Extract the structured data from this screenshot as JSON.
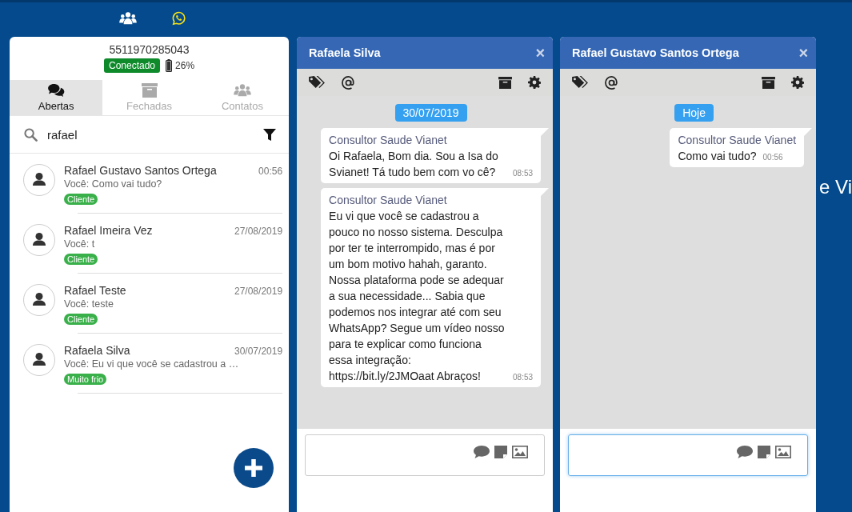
{
  "top_nav": [
    {
      "kind": "team",
      "selected": false
    },
    {
      "kind": "whatsapp",
      "selected": true
    }
  ],
  "sidebar": {
    "phone": "5511970285043",
    "status": "Conectado",
    "battery": "26%",
    "tabs": [
      {
        "label": "Abertas",
        "kind": "chats",
        "selected": true
      },
      {
        "label": "Fechadas",
        "kind": "archive",
        "selected": false
      },
      {
        "label": "Contatos",
        "kind": "team",
        "selected": false
      }
    ],
    "search": {
      "value": "rafael"
    },
    "conversations": [
      {
        "name": "Rafael Gustavo Santos Ortega",
        "time": "00:56",
        "preview": "Você: Como vai tudo?",
        "tag": "Cliente"
      },
      {
        "name": "Rafael Imeira Vez",
        "time": "27/08/2019",
        "preview": "Você: t",
        "tag": "Cliente"
      },
      {
        "name": "Rafael Teste",
        "time": "27/08/2019",
        "preview": "Você: teste",
        "tag": "Cliente"
      },
      {
        "name": "Rafaela Silva",
        "time": "30/07/2019",
        "preview": "Você: Eu vi que você se cadastrou a …",
        "tag": "Muito frio"
      }
    ]
  },
  "chats": [
    {
      "title": "Rafaela Silva",
      "close": "×",
      "date": "30/07/2019",
      "focused": false,
      "messages": [
        {
          "sender": "Consultor Saude Vianet",
          "text": "Oi Rafaela, Bom dia. Sou a Isa do Svianet! Tá tudo bem com vo cê?",
          "time": "08:53"
        },
        {
          "sender": "Consultor Saude Vianet",
          "text": "Eu vi que você se cadastrou a pouco no nosso sistema. Desculpa por ter te interrompido, mas é por um bom motivo hahah, garanto. Nossa plataforma pode se adequar a sua necessidade... Sabia que podemos nos integrar até com seu WhatsApp? Segue um vídeo nosso para te explicar como funciona essa integração: https://bit.ly/2JMOaat Abraços!",
          "time": "08:53"
        }
      ]
    },
    {
      "title": "Rafael Gustavo Santos Ortega",
      "close": "×",
      "date": "Hoje",
      "focused": true,
      "messages": [
        {
          "sender": "Consultor Saude Vianet",
          "text": "Como vai tudo?",
          "time": "00:56"
        }
      ]
    }
  ],
  "background_text": "e Vi"
}
